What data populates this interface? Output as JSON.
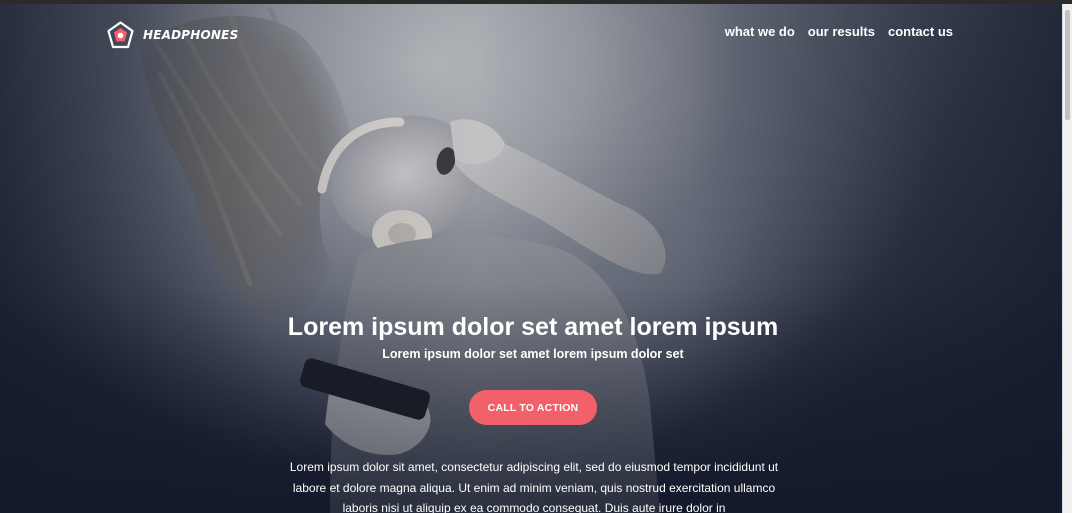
{
  "brand": {
    "name": "HEADPHONES",
    "logo_icon": "pentagon-headphones-logo-icon",
    "accent_color": "#f2606a"
  },
  "nav": {
    "items": [
      {
        "label": "what we do"
      },
      {
        "label": "our results"
      },
      {
        "label": "contact us"
      }
    ]
  },
  "hero": {
    "headline": "Lorem ipsum dolor set amet lorem ipsum",
    "subheadline": "Lorem ipsum dolor set amet lorem ipsum dolor set",
    "cta_label": "CALL TO ACTION",
    "body": "Lorem ipsum dolor sit amet, consectetur adipiscing elit, sed do eiusmod tempor incididunt ut labore et dolore magna aliqua. Ut enim ad minim veniam, quis nostrud exercitation ullamco laboris nisi ut aliquip ex ea commodo consequat. Duis aute irure dolor in",
    "background_icon": "woman-listening-headphones-photo"
  }
}
